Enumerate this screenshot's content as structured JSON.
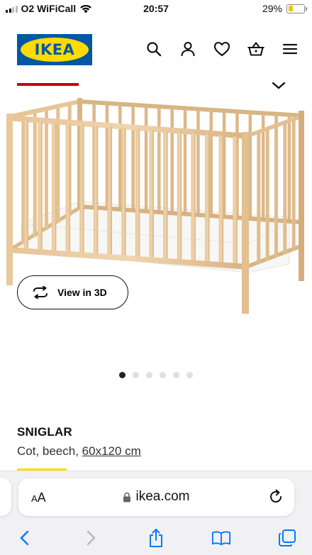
{
  "status_bar": {
    "carrier": "O2 WiFiCall",
    "time": "20:57",
    "battery_percent": "29%",
    "battery_level": 0.29
  },
  "header": {
    "logo_text": "IKEA",
    "icons": [
      "search-icon",
      "account-icon",
      "wishlist-icon",
      "basket-icon",
      "menu-icon"
    ]
  },
  "gallery": {
    "view_3d_label": "View in 3D",
    "image_count": 6,
    "active_index": 0
  },
  "product": {
    "name": "SNIGLAR",
    "description": "Cot, beech, ",
    "size": "60x120 cm"
  },
  "browser": {
    "aa_label_small": "A",
    "aa_label_large": "A",
    "url": "ikea.com"
  },
  "colors": {
    "ikea_blue": "#0058a3",
    "ikea_yellow": "#ffdb00",
    "ikea_red": "#cc0008",
    "link_blue": "#007aff"
  }
}
